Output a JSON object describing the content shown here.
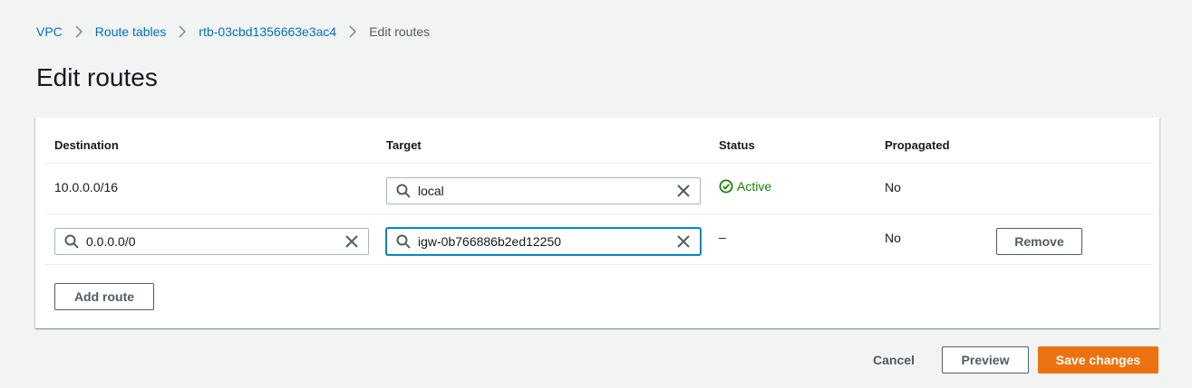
{
  "breadcrumb": {
    "items": [
      {
        "label": "VPC"
      },
      {
        "label": "Route tables"
      },
      {
        "label": "rtb-03cbd1356663e3ac4"
      },
      {
        "label": "Edit routes"
      }
    ]
  },
  "page": {
    "title": "Edit routes"
  },
  "table": {
    "headers": {
      "destination": "Destination",
      "target": "Target",
      "status": "Status",
      "propagated": "Propagated"
    },
    "rows": [
      {
        "destination": "10.0.0.0/16",
        "target": "local",
        "status": "Active",
        "propagated": "No"
      },
      {
        "destination": "0.0.0.0/0",
        "target": "igw-0b766886b2ed12250",
        "status": "–",
        "propagated": "No",
        "remove_label": "Remove"
      }
    ],
    "add_route_label": "Add route"
  },
  "footer": {
    "cancel_label": "Cancel",
    "preview_label": "Preview",
    "save_label": "Save changes"
  },
  "colors": {
    "link": "#0073bb",
    "active_status": "#1d8102",
    "primary_button": "#ec7211",
    "focus_ring": "#00a1c9"
  },
  "icons": {
    "breadcrumb_separator": "chevron-right-icon",
    "search": "search-icon",
    "clear": "close-icon",
    "status_active": "check-circle-icon"
  }
}
